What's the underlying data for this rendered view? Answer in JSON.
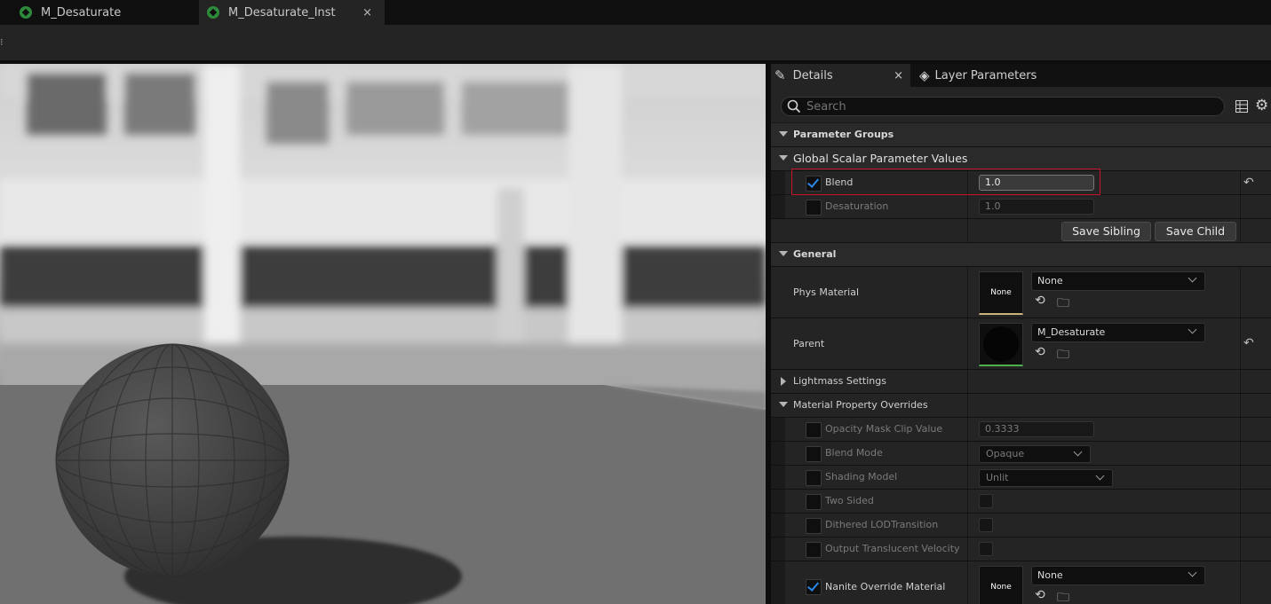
{
  "tabs": [
    {
      "label": "M_Desaturate",
      "icon": "material-icon",
      "active": false
    },
    {
      "label": "M_Desaturate_Inst",
      "icon": "material-instance-icon",
      "active": true,
      "close": "×"
    }
  ],
  "toolbar": {
    "overflow": "⁝"
  },
  "panel": {
    "tabs": [
      {
        "label": "Details",
        "icon": "pencil-icon",
        "close": "×"
      },
      {
        "label": "Layer Parameters",
        "icon": "layers-icon"
      }
    ],
    "search": {
      "placeholder": "Search"
    },
    "sections": {
      "parameter_groups": "Parameter Groups",
      "global_scalar": "Global Scalar Parameter Values",
      "general": "General",
      "lightmass": "Lightmass Settings",
      "material_overrides": "Material Property Overrides"
    },
    "scalar_params": [
      {
        "label": "Blend",
        "value": "1.0",
        "enabled": true
      },
      {
        "label": "Desaturation",
        "value": "1.0",
        "enabled": false
      }
    ],
    "buttons": {
      "save_sibling": "Save Sibling",
      "save_child": "Save Child"
    },
    "general": {
      "phys_material": {
        "label": "Phys Material",
        "thumb": "None",
        "value": "None"
      },
      "parent": {
        "label": "Parent",
        "value": "M_Desaturate"
      }
    },
    "overrides": {
      "opacity_mask": {
        "label": "Opacity Mask Clip Value",
        "value": "0.3333"
      },
      "blend_mode": {
        "label": "Blend Mode",
        "value": "Opaque"
      },
      "shading_model": {
        "label": "Shading Model",
        "value": "Unlit"
      },
      "two_sided": {
        "label": "Two Sided"
      },
      "dithered": {
        "label": "Dithered LODTransition"
      },
      "translucent_velocity": {
        "label": "Output Translucent Velocity"
      },
      "nanite": {
        "label": "Nanite Override Material",
        "thumb": "None",
        "value": "None",
        "enabled": true
      }
    }
  },
  "colors": {
    "highlight": "#c3152a",
    "accent": "#2b86ea",
    "tab_icon": "#2c8a3a"
  }
}
